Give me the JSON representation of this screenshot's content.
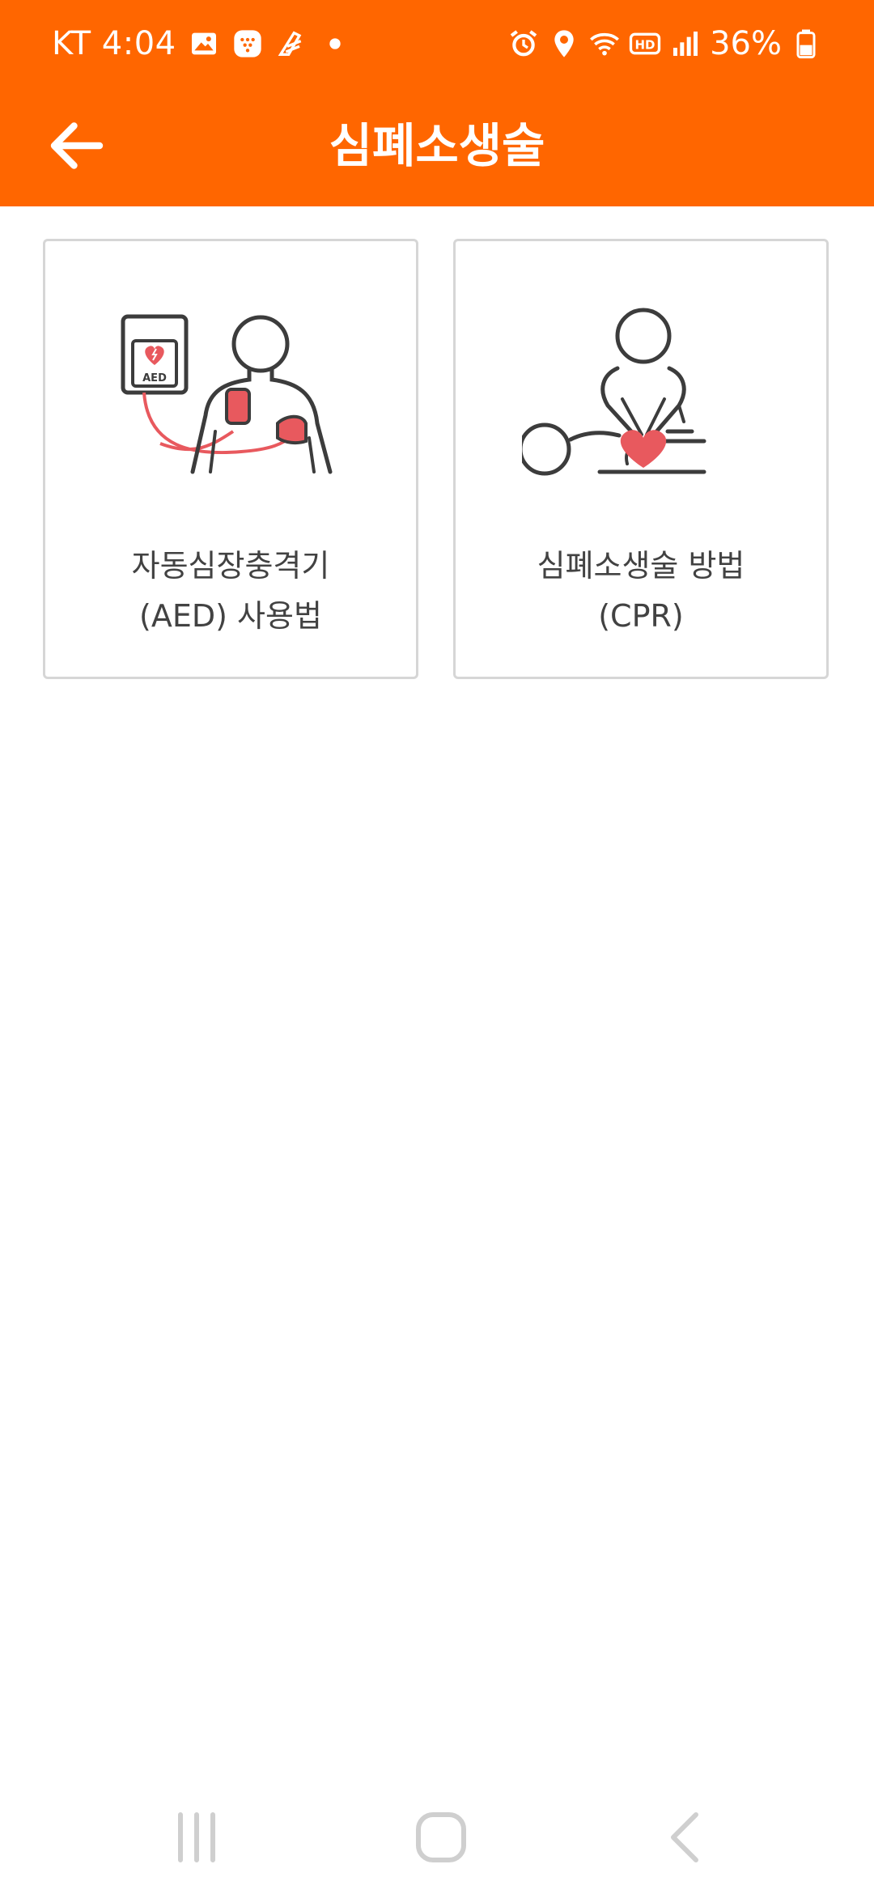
{
  "status_bar": {
    "carrier": "KT",
    "time": "4:04",
    "battery_percent": "36%",
    "left_icons": [
      "image-icon",
      "messenger-icon",
      "app-icon",
      "dot-icon"
    ],
    "right_icons": [
      "alarm-icon",
      "location-icon",
      "wifi-icon",
      "hd-icon",
      "signal-icon",
      "battery-icon"
    ]
  },
  "header": {
    "title": "심폐소생술",
    "back_icon": "arrow-left-icon",
    "background_color": "#FF6600"
  },
  "cards": [
    {
      "icon": "aed-illustration-icon",
      "line1": "자동심장충격기",
      "line2": "(AED) 사용법"
    },
    {
      "icon": "cpr-illustration-icon",
      "line1": "심폐소생술 방법",
      "line2": "(CPR)"
    }
  ],
  "aed_device_label": "AED",
  "navigation_bar": {
    "recents_icon": "recents-icon",
    "home_icon": "home-icon",
    "back_icon": "nav-back-icon"
  },
  "colors": {
    "accent": "#FF6600",
    "heart": "#E8595E",
    "line": "#3c3c3c"
  }
}
